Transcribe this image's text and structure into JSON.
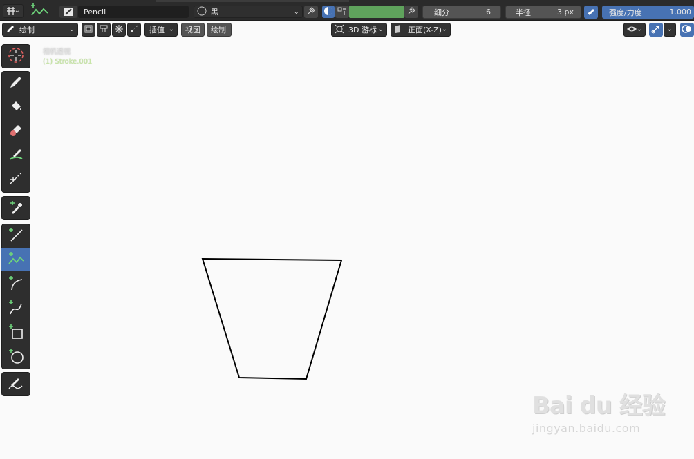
{
  "header": {
    "mode_icon": "editor-type-icon",
    "brush_name": "Pencil",
    "material_name": "黑",
    "subdivisions_label": "细分",
    "subdivisions_value": "6",
    "radius_label": "半径",
    "radius_value": "3 px",
    "strength_label": "强度/力度",
    "strength_value": "1.000",
    "color_swatch": "#5fa35c",
    "accent": "#4772b3"
  },
  "toolbar2": {
    "mode_label": "绘制",
    "interp_label": "插值",
    "view_label": "视图",
    "draw_label": "绘制",
    "cursor_label": "3D 游标",
    "view_plane_label": "正面(X-Z)"
  },
  "viewport": {
    "camera_label": "相机透视",
    "object_label": "(1) Stroke.001",
    "stroke_color": "#000000"
  },
  "tools": [
    {
      "name": "cursor-tool",
      "icon": "cursor-icon"
    },
    {
      "name": "draw-tool",
      "icon": "pencil-icon"
    },
    {
      "name": "fill-tool",
      "icon": "fill-bucket-icon"
    },
    {
      "name": "erase-tool",
      "icon": "eraser-icon"
    },
    {
      "name": "tint-tool",
      "icon": "tint-brush-icon"
    },
    {
      "name": "cutter-tool",
      "icon": "cutter-icon"
    },
    {
      "name": "eyedropper-tool",
      "icon": "eyedropper-icon"
    },
    {
      "name": "line-tool",
      "icon": "line-icon"
    },
    {
      "name": "polyline-tool",
      "icon": "polyline-icon"
    },
    {
      "name": "arc-tool",
      "icon": "arc-icon"
    },
    {
      "name": "curve-tool",
      "icon": "curve-icon"
    },
    {
      "name": "box-tool",
      "icon": "box-icon"
    },
    {
      "name": "circle-tool",
      "icon": "circle-icon"
    },
    {
      "name": "annotate-tool",
      "icon": "annotate-icon"
    }
  ],
  "watermark": {
    "brand": "Bai du 经验",
    "url": "jingyan.baidu.com"
  }
}
